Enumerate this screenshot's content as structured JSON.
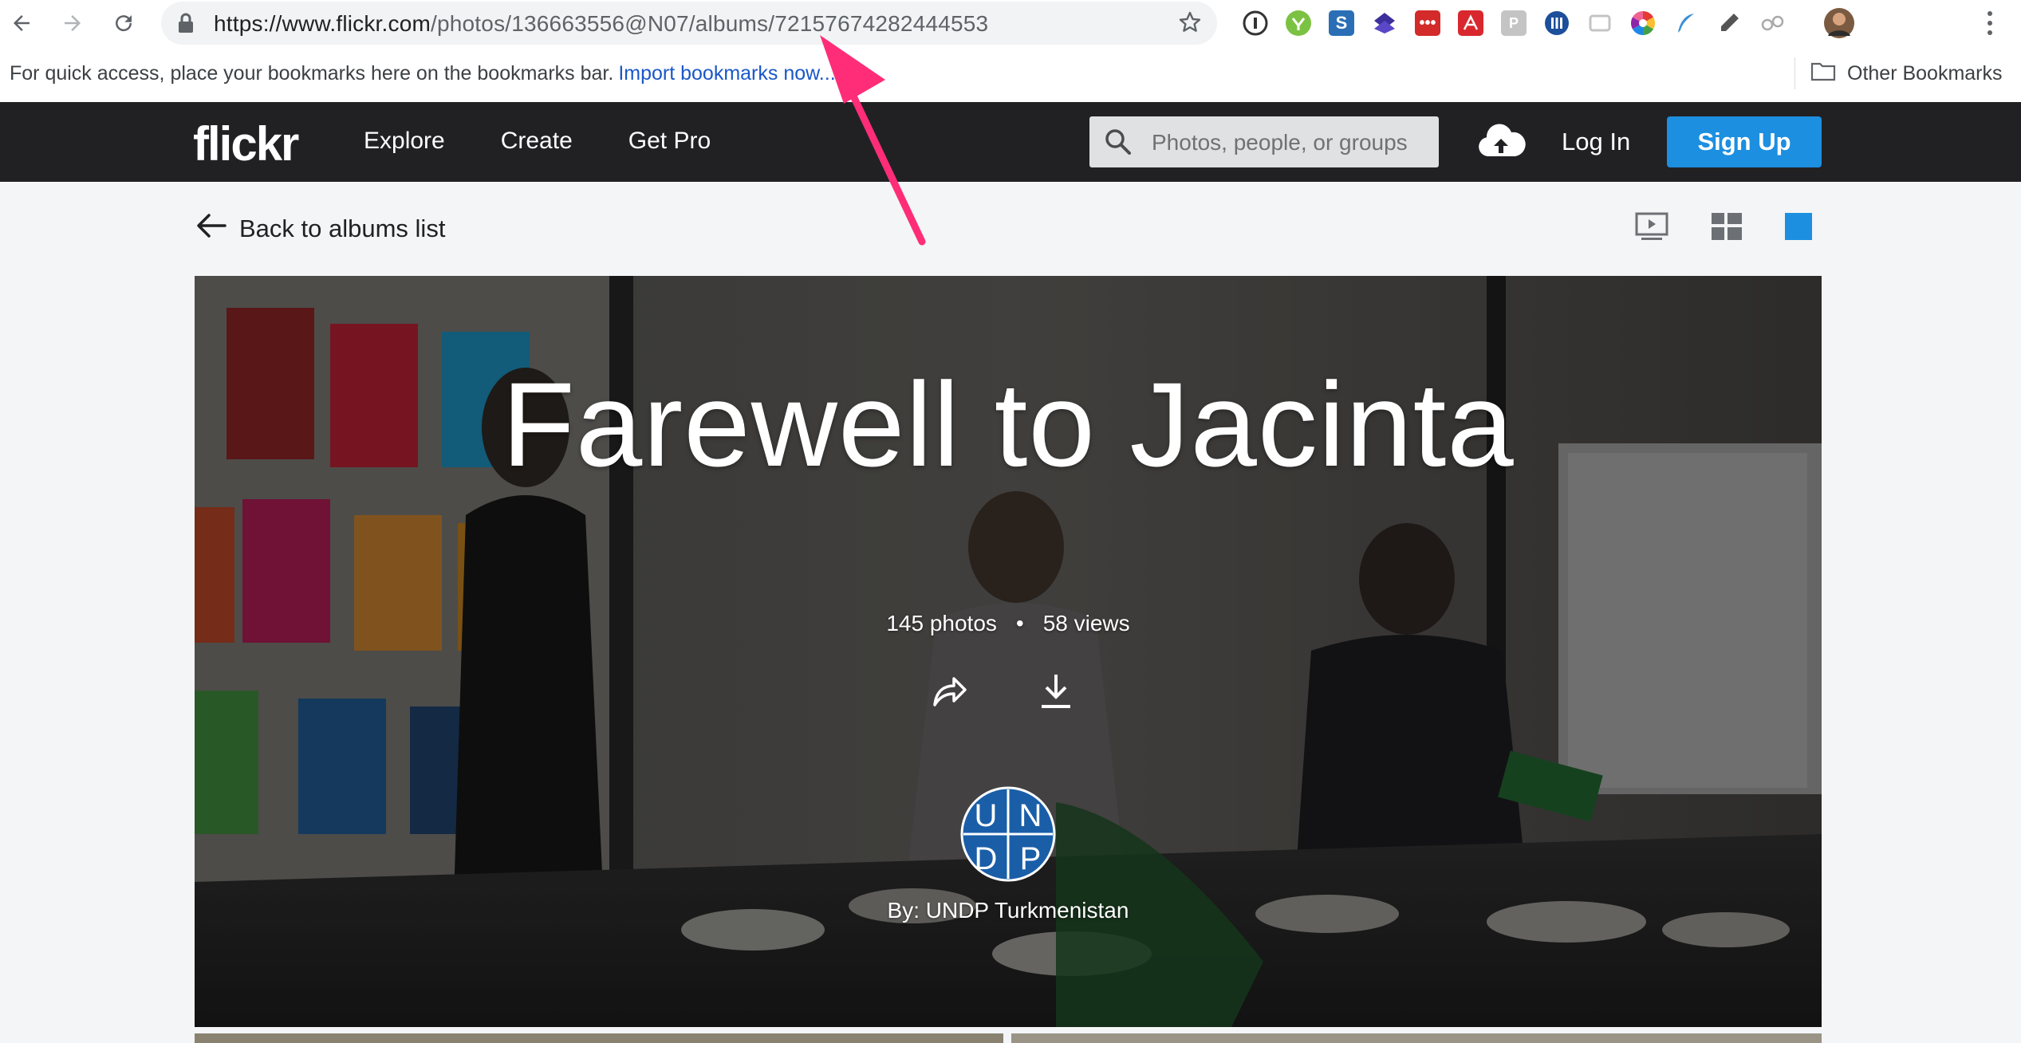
{
  "browser": {
    "url_host": "https://www.flickr.com",
    "url_path": "/photos/136663556@N07/albums/72157674282444553",
    "extensions": [
      "1password-icon",
      "grammarly-icon",
      "stylebot-icon",
      "layers-icon",
      "chat-ext-icon",
      "acrobat-icon",
      "p-ext-icon",
      "library-icon",
      "screenshot-icon",
      "color-wheel-icon",
      "feather-icon",
      "eyedropper-icon",
      "glasses-icon",
      "profile-avatar"
    ]
  },
  "bookmarks": {
    "prompt": "For quick access, place your bookmarks here on the bookmarks bar.",
    "import_link": "Import bookmarks now...",
    "other": "Other Bookmarks"
  },
  "flickr": {
    "logo": "flickr",
    "nav": [
      "Explore",
      "Create",
      "Get Pro"
    ],
    "search_placeholder": "Photos, people, or groups",
    "login": "Log In",
    "signup": "Sign Up"
  },
  "album": {
    "back": "Back to albums list",
    "title": "Farewell to Jacinta",
    "photos": "145 photos",
    "views": "58 views",
    "owner": "By: UNDP Turkmenistan",
    "avatar_letters": [
      "U",
      "N",
      "D",
      "P"
    ]
  },
  "colors": {
    "flickr_dark": "#212124",
    "signup_blue": "#1c8fe0",
    "annotation_pink": "#ff2d78",
    "undp_blue": "#1a5ea8"
  }
}
